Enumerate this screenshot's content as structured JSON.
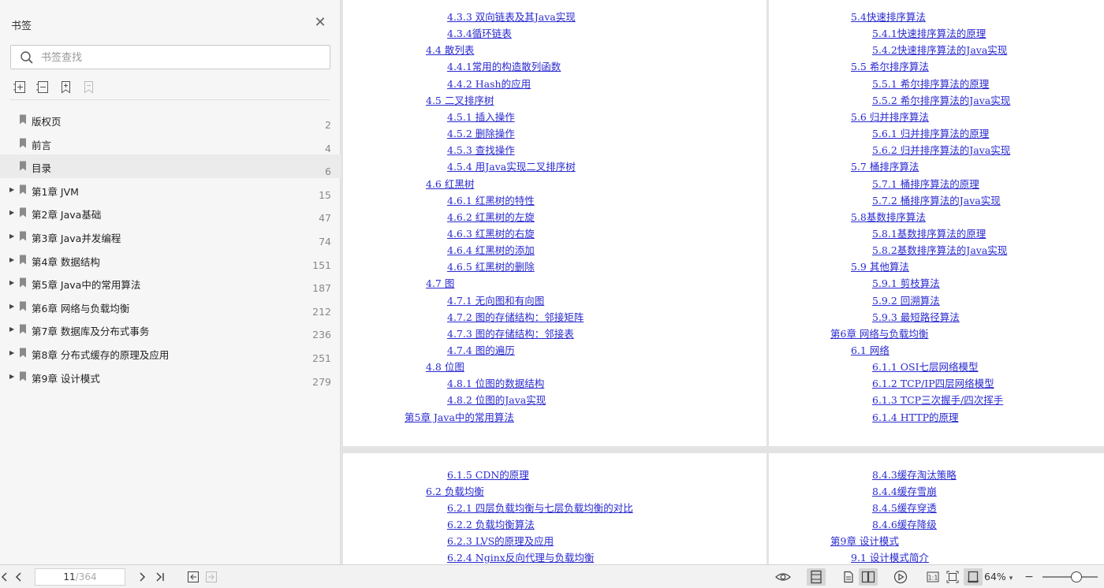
{
  "sidebar": {
    "title": "书签",
    "search_placeholder": "书签查找",
    "bookmarks": [
      {
        "label": "版权页",
        "page": "2",
        "expandable": false
      },
      {
        "label": "前言",
        "page": "4",
        "expandable": false
      },
      {
        "label": "目录",
        "page": "6",
        "expandable": false
      },
      {
        "label": "第1章 JVM",
        "page": "15",
        "expandable": true
      },
      {
        "label": "第2章 Java基础",
        "page": "47",
        "expandable": true
      },
      {
        "label": "第3章 Java并发编程",
        "page": "74",
        "expandable": true
      },
      {
        "label": "第4章 数据结构",
        "page": "151",
        "expandable": true
      },
      {
        "label": "第5章 Java中的常用算法",
        "page": "187",
        "expandable": true
      },
      {
        "label": "第6章 网络与负载均衡",
        "page": "212",
        "expandable": true
      },
      {
        "label": "第7章 数据库及分布式事务",
        "page": "236",
        "expandable": true
      },
      {
        "label": "第8章 分布式缓存的原理及应用",
        "page": "251",
        "expandable": true
      },
      {
        "label": "第9章 设计模式",
        "page": "279",
        "expandable": true
      }
    ]
  },
  "pages": {
    "top_left": [
      {
        "text": "4.3.3 双向链表及其Java实现",
        "level": 3
      },
      {
        "text": "4.3.4循环链表",
        "level": 3
      },
      {
        "text": "4.4 散列表",
        "level": 2
      },
      {
        "text": "4.4.1常用的构造散列函数",
        "level": 3
      },
      {
        "text": "4.4.2 Hash的应用",
        "level": 3
      },
      {
        "text": "4.5 二叉排序树",
        "level": 2
      },
      {
        "text": "4.5.1 插入操作",
        "level": 3
      },
      {
        "text": "4.5.2 删除操作",
        "level": 3
      },
      {
        "text": "4.5.3 查找操作",
        "level": 3
      },
      {
        "text": "4.5.4 用Java实现二叉排序树",
        "level": 3
      },
      {
        "text": "4.6 红黑树",
        "level": 2
      },
      {
        "text": "4.6.1 红黑树的特性",
        "level": 3
      },
      {
        "text": "4.6.2 红黑树的左旋",
        "level": 3
      },
      {
        "text": "4.6.3 红黑树的右旋",
        "level": 3
      },
      {
        "text": "4.6.4 红黑树的添加",
        "level": 3
      },
      {
        "text": "4.6.5 红黑树的删除",
        "level": 3
      },
      {
        "text": "4.7 图",
        "level": 2
      },
      {
        "text": "4.7.1 无向图和有向图",
        "level": 3
      },
      {
        "text": "4.7.2 图的存储结构：邻接矩阵",
        "level": 3
      },
      {
        "text": "4.7.3 图的存储结构：邻接表",
        "level": 3
      },
      {
        "text": "4.7.4 图的遍历",
        "level": 3
      },
      {
        "text": "4.8 位图",
        "level": 2
      },
      {
        "text": "4.8.1 位图的数据结构",
        "level": 3
      },
      {
        "text": "4.8.2 位图的Java实现",
        "level": 3
      },
      {
        "text": "第5章 Java中的常用算法",
        "level": 1
      }
    ],
    "top_right": [
      {
        "text": "5.4快速排序算法",
        "level": 2
      },
      {
        "text": "5.4.1快速排序算法的原理",
        "level": 3
      },
      {
        "text": "5.4.2快速排序算法的Java实现",
        "level": 3
      },
      {
        "text": "5.5 希尔排序算法",
        "level": 2
      },
      {
        "text": "5.5.1 希尔排序算法的原理",
        "level": 3
      },
      {
        "text": "5.5.2 希尔排序算法的Java实现",
        "level": 3
      },
      {
        "text": "5.6 归并排序算法",
        "level": 2
      },
      {
        "text": "5.6.1 归并排序算法的原理",
        "level": 3
      },
      {
        "text": "5.6.2 归并排序算法的Java实现",
        "level": 3
      },
      {
        "text": "5.7 桶排序算法",
        "level": 2
      },
      {
        "text": "5.7.1 桶排序算法的原理",
        "level": 3
      },
      {
        "text": "5.7.2 桶排序算法的Java实现",
        "level": 3
      },
      {
        "text": "5.8基数排序算法",
        "level": 2
      },
      {
        "text": "5.8.1基数排序算法的原理",
        "level": 3
      },
      {
        "text": "5.8.2基数排序算法的Java实现",
        "level": 3
      },
      {
        "text": "5.9 其他算法",
        "level": 2
      },
      {
        "text": "5.9.1 剪枝算法",
        "level": 3
      },
      {
        "text": "5.9.2 回溯算法",
        "level": 3
      },
      {
        "text": "5.9.3 最短路径算法",
        "level": 3
      },
      {
        "text": "第6章 网络与负载均衡",
        "level": 1
      },
      {
        "text": "6.1 网络",
        "level": 2
      },
      {
        "text": "6.1.1 OSI七层网络模型",
        "level": 3
      },
      {
        "text": "6.1.2 TCP/IP四层网络模型",
        "level": 3
      },
      {
        "text": "6.1.3 TCP三次握手/四次挥手",
        "level": 3
      },
      {
        "text": "6.1.4 HTTP的原理",
        "level": 3
      }
    ],
    "bottom_left": [
      {
        "text": "6.1.5 CDN的原理",
        "level": 3
      },
      {
        "text": "6.2 负载均衡",
        "level": 2
      },
      {
        "text": "6.2.1 四层负载均衡与七层负载均衡的对比",
        "level": 3
      },
      {
        "text": "6.2.2 负载均衡算法",
        "level": 3
      },
      {
        "text": "6.2.3 LVS的原理及应用",
        "level": 3
      },
      {
        "text": "6.2.4 Nginx反向代理与负载均衡",
        "level": 3
      }
    ],
    "bottom_right": [
      {
        "text": "8.4.3缓存淘汰策略",
        "level": 3
      },
      {
        "text": "8.4.4缓存雪崩",
        "level": 3
      },
      {
        "text": "8.4.5缓存穿透",
        "level": 3
      },
      {
        "text": "8.4.6缓存降级",
        "level": 3
      },
      {
        "text": "第9章 设计模式",
        "level": 1
      },
      {
        "text": "9.1 设计模式简介",
        "level": 2
      }
    ]
  },
  "statusbar": {
    "current_page": "11",
    "total_pages": "/364",
    "zoom": "64%"
  },
  "colors": {
    "link": "#2a2acf",
    "sidebar_bg": "#f6f6f6"
  }
}
